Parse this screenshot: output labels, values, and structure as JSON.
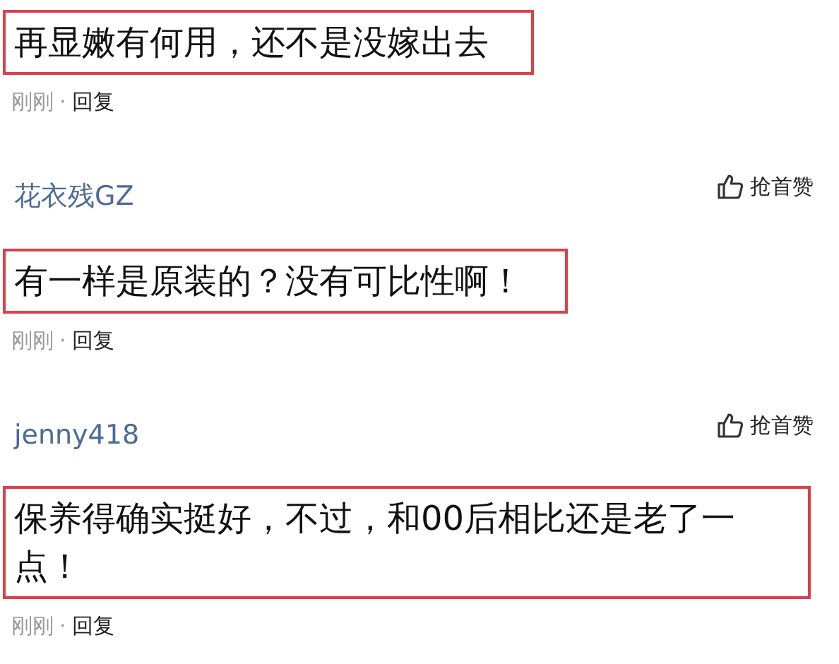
{
  "comments": [
    {
      "text": "再显嫩有何用，还不是没嫁出去",
      "highlighted": true,
      "time": "刚刚",
      "separator": "·",
      "reply": "回复"
    },
    {
      "author": "花衣残GZ",
      "text": "有一样是原装的？没有可比性啊！",
      "highlighted": true,
      "time": "刚刚",
      "separator": "·",
      "reply": "回复",
      "like": "抢首赞"
    },
    {
      "author": "jenny418",
      "text": "保养得确实挺好，不过，和00后相比还是老了一点！",
      "highlighted": true,
      "time": "刚刚",
      "separator": "·",
      "reply": "回复",
      "like": "抢首赞"
    }
  ]
}
